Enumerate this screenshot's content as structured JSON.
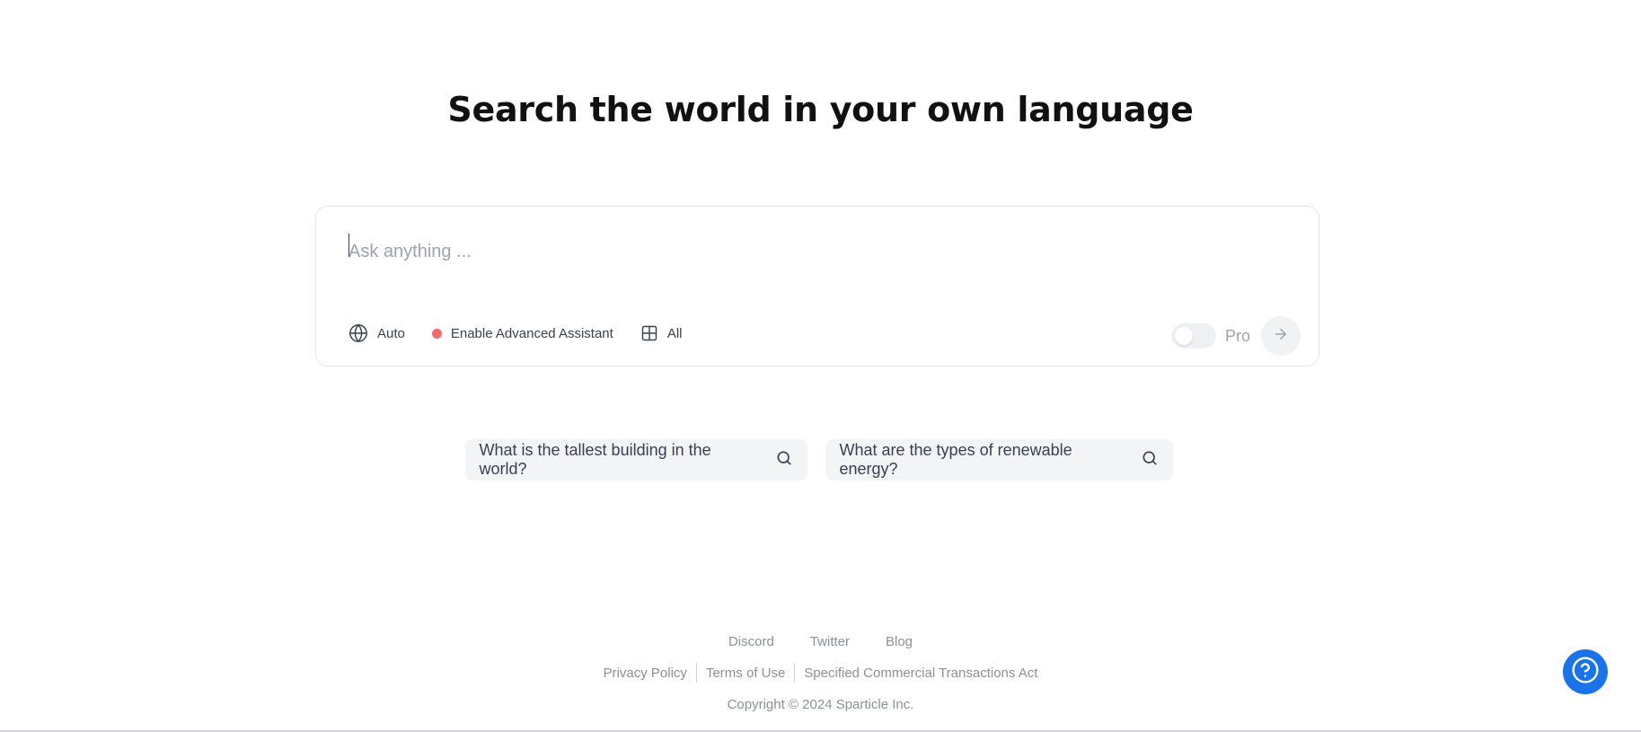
{
  "headline": "Search the world in your own language",
  "search": {
    "placeholder": "Ask anything ...",
    "value": ""
  },
  "toolbar": {
    "language_label": "Auto",
    "assistant_label": "Enable Advanced Assistant",
    "assistant_dot_color": "#f06c6c",
    "scope_label": "All"
  },
  "pro": {
    "label": "Pro",
    "enabled": false
  },
  "suggestions": [
    {
      "text": "What is the tallest building in the world?"
    },
    {
      "text": "What are the types of renewable energy?"
    }
  ],
  "footer": {
    "social_links": [
      "Discord",
      "Twitter",
      "Blog"
    ],
    "legal_links": [
      "Privacy Policy",
      "Terms of Use",
      "Specified Commercial Transactions Act"
    ],
    "copyright": "Copyright © 2024 Sparticle Inc."
  },
  "colors": {
    "help_button": "#1a73e8",
    "text_primary": "#111111",
    "text_muted": "#8b9099"
  }
}
